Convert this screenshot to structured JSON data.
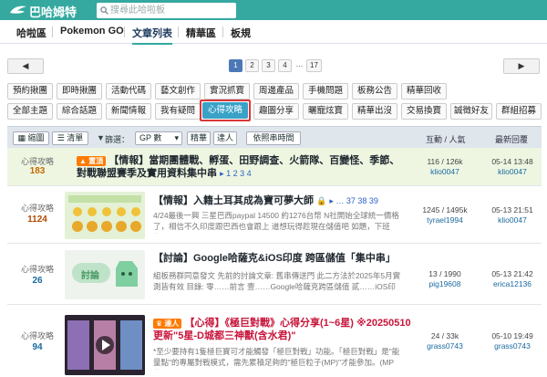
{
  "header": {
    "logo_text": "巴哈姆特",
    "search_placeholder": "搜尋此哈啦板"
  },
  "nav": {
    "items": [
      {
        "label": "哈啦區"
      },
      {
        "label": "Pokemon GO"
      },
      {
        "label": "文章列表"
      },
      {
        "label": "精華區"
      },
      {
        "label": "板規"
      }
    ]
  },
  "pager": {
    "prev": "◀",
    "next": "▶",
    "pages": [
      "1",
      "2",
      "3",
      "4",
      "…",
      "17"
    ],
    "current": "1"
  },
  "categories": {
    "row1": [
      "預約揪團",
      "即時揪團",
      "活動代碼",
      "藝文創作",
      "實況抓寶",
      "周邊產品",
      "手機問題",
      "板務公告",
      "精華回收"
    ],
    "row2": [
      "全部主題",
      "綜合話題",
      "新聞情報",
      "我有疑問",
      "心得攻略",
      "趣圖分享",
      "曬寵炫寶",
      "精華出沒",
      "交易換寶",
      "誠徵好友",
      "群組招募"
    ],
    "selected": "心得攻略"
  },
  "toolbar": {
    "view_thumb": "縮圖",
    "view_list": "清單",
    "filter_label": "篩選：",
    "filter_value": "GP 數",
    "essence": "精華",
    "master": "達人",
    "sort_time": "依照串時間",
    "col_stats": "互動 / 人氣",
    "col_last": "最新回覆"
  },
  "posts": [
    {
      "category": "心得攻略",
      "count": "183",
      "pinned_badge": "置頂",
      "title": "【情報】當期團體戰、孵蛋、田野調查、火箭隊、百變怪、季節、對戰聯盟賽季及實用資料集中串",
      "pages": "▸ 1 2 3 4",
      "interactions": "116 / 126k",
      "author": "klio0047",
      "last_time": "05-14 13:48",
      "last_user": "klio0047"
    },
    {
      "category": "心得攻略",
      "count": "1124",
      "title": "【情報】入籍土耳其成為寶可夢大師",
      "pages": "▸ … 37 38 39",
      "desc": "4/24最後一興 三星巴西paypal 14500 約1276台幣 N社開始全球統一價格了，相信不久印度跟巴西也會跟上 道想玩得趁現在儲值吧 如題，下班後...",
      "interactions": "1245 / 1495k",
      "author": "tyrael1994",
      "last_time": "05-13 21:51",
      "last_user": "klio0047"
    },
    {
      "category": "心得攻略",
      "count": "26",
      "title": "【討論】Google哈薩克&iOS印度 跨區儲值「集中串」",
      "desc": "組板務群同意發文 先前的討論文章: 舊串傳送門 此二方法於2025年5月實測皆有效 目錄: 零……前言 壹……Google哈薩克跨區儲值 貳……iOS印度...",
      "interactions": "13 / 1990",
      "author": "pig19608",
      "last_time": "05-13 21:42",
      "last_user": "erica12136"
    },
    {
      "category": "心得攻略",
      "count": "94",
      "badge": "達人",
      "title": "【心得】《極巨對戰》心得分享(1~6星) ※20250510更新\"5星-D城都三神獸(含水君)\"",
      "desc": "*至少要持有1隻極巨寶可才能觸發「極巨對戰」功能。「極巨對戰」是\"能量點\"的專屬對戰模式，需先累積足夠的\"極巨粒子(MP)\"才能參加。(MP收...",
      "interactions": "24 / 33k",
      "author": "grass0743",
      "last_time": "05-10 19:49",
      "last_user": "grass0743"
    }
  ],
  "thumb_label": "討論"
}
